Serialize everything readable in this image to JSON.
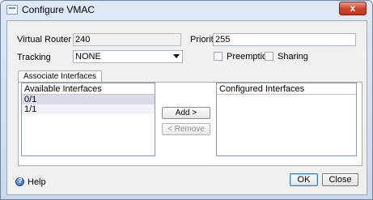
{
  "window": {
    "title": "Configure VMAC",
    "close_label": "x"
  },
  "form": {
    "virtual_router_id": {
      "label": "Virtual Router ID*",
      "value": "240"
    },
    "priority": {
      "label": "Priority",
      "value": "255"
    },
    "tracking": {
      "label": "Tracking",
      "value": "NONE"
    },
    "preemption": {
      "label": "Preemption",
      "checked": false
    },
    "sharing": {
      "label": "Sharing",
      "checked": false
    }
  },
  "tabs": [
    {
      "label": "Associate Interfaces",
      "active": true
    }
  ],
  "available_interfaces": {
    "header": "Available Interfaces",
    "items": [
      "0/1",
      "1/1"
    ]
  },
  "configured_interfaces": {
    "header": "Configured Interfaces",
    "items": []
  },
  "buttons": {
    "add": "Add >",
    "remove": "< Remove",
    "help": "Help",
    "ok": "OK",
    "close": "Close"
  },
  "icons": {
    "window": "window-icon",
    "close": "close-icon",
    "help": "help-icon",
    "dropdown": "chevron-down-icon"
  }
}
